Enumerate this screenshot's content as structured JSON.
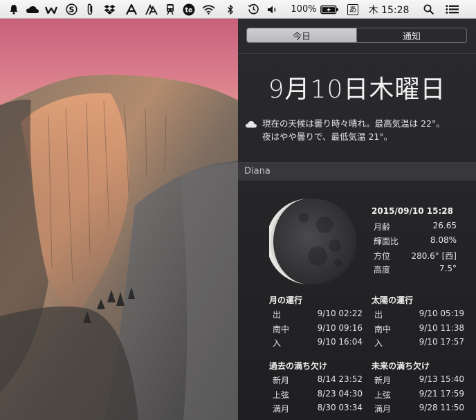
{
  "menubar": {
    "icons": [
      "notification-bell-icon",
      "creative-cloud-icon",
      "evernote-w-icon",
      "s-circle-icon",
      "paperclip-icon",
      "dropbox-icon",
      "font-a-icon",
      "typesetting-a-icon",
      "train-icon",
      "te-circle-icon",
      "wifi-icon",
      "bluetooth-icon",
      "time-machine-icon",
      "volume-icon"
    ],
    "battery_text": "100%",
    "input_method": "あ",
    "clock": "木 15:28",
    "right_icons": [
      "spotlight-search-icon",
      "notification-center-icon"
    ]
  },
  "nc": {
    "tabs": {
      "today": "今日",
      "notifications": "通知"
    },
    "date": "9月10日木曜日",
    "weather": {
      "line1": "現在の天候は曇り時々晴れ。最高気温は 22°。",
      "line2": "夜はやや曇りで、最低気温 21°。"
    },
    "diana": {
      "title": "Diana",
      "datetime": "2015/09/10 15:28",
      "stats": [
        {
          "k": "月齢",
          "v": "26.65"
        },
        {
          "k": "輝面比",
          "v": "8.08%"
        },
        {
          "k": "方位",
          "v": "280.6° [西]"
        },
        {
          "k": "高度",
          "v": "7.5°"
        }
      ],
      "moon_motion": {
        "title": "月の運行",
        "rows": [
          {
            "k": "出",
            "v": "9/10 02:22"
          },
          {
            "k": "南中",
            "v": "9/10 09:16"
          },
          {
            "k": "入",
            "v": "9/10 16:04"
          }
        ]
      },
      "sun_motion": {
        "title": "太陽の運行",
        "rows": [
          {
            "k": "出",
            "v": "9/10 05:19"
          },
          {
            "k": "南中",
            "v": "9/10 11:38"
          },
          {
            "k": "入",
            "v": "9/10 17:57"
          }
        ]
      },
      "past_phases": {
        "title": "過去の満ち欠け",
        "rows": [
          {
            "k": "新月",
            "v": "8/14 23:52"
          },
          {
            "k": "上弦",
            "v": "8/23 04:30"
          },
          {
            "k": "満月",
            "v": "8/30 03:34"
          }
        ]
      },
      "future_phases": {
        "title": "未来の満ち欠け",
        "rows": [
          {
            "k": "新月",
            "v": "9/13 15:40"
          },
          {
            "k": "上弦",
            "v": "9/21 17:59"
          },
          {
            "k": "満月",
            "v": "9/28 11:50"
          }
        ]
      }
    }
  }
}
